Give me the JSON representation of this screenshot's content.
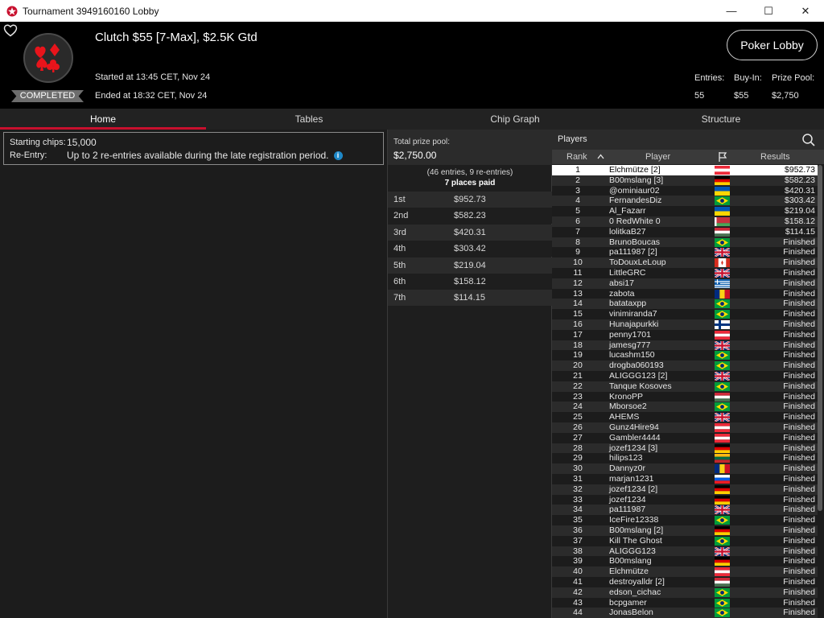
{
  "window": {
    "title": "Tournament 3949160160 Lobby",
    "minimize": "—",
    "maximize": "☐",
    "close": "✕"
  },
  "header": {
    "tournament_name": "Clutch $55 [7-Max], $2.5K Gtd",
    "status": "COMPLETED",
    "started": "Started at 13:45 CET, Nov 24",
    "ended": "Ended at 18:32 CET, Nov 24",
    "poker_lobby_label": "Poker Lobby",
    "entries_label": "Entries:",
    "entries_value": "55",
    "buyin_label": "Buy-In:",
    "buyin_value": "$55",
    "prizepool_label": "Prize Pool:",
    "prizepool_value": "$2,750"
  },
  "tabs": [
    {
      "label": "Home",
      "active": true
    },
    {
      "label": "Tables",
      "active": false
    },
    {
      "label": "Chip Graph",
      "active": false
    },
    {
      "label": "Structure",
      "active": false
    }
  ],
  "home": {
    "starting_chips_label": "Starting chips:",
    "starting_chips_value": "15,000",
    "reentry_label": "Re-Entry:",
    "reentry_value": "Up to 2 re-entries available during the late registration period.",
    "info_icon": "i"
  },
  "prize": {
    "total_label": "Total prize pool:",
    "total_value": "$2,750.00",
    "entries_note": "(46 entries, 9 re-entries)",
    "places_paid": "7 places paid",
    "places": [
      {
        "place": "1st",
        "amount": "$952.73"
      },
      {
        "place": "2nd",
        "amount": "$582.23"
      },
      {
        "place": "3rd",
        "amount": "$420.31"
      },
      {
        "place": "4th",
        "amount": "$303.42"
      },
      {
        "place": "5th",
        "amount": "$219.04"
      },
      {
        "place": "6th",
        "amount": "$158.12"
      },
      {
        "place": "7th",
        "amount": "$114.15"
      }
    ]
  },
  "players": {
    "title": "Players",
    "columns": {
      "rank": "Rank",
      "player": "Player",
      "results": "Results"
    },
    "rows": [
      {
        "rank": "1",
        "name": "Elchmütze [2]",
        "flag": "austria",
        "result": "$952.73"
      },
      {
        "rank": "2",
        "name": "B00mslang [3]",
        "flag": "germany",
        "result": "$582.23"
      },
      {
        "rank": "3",
        "name": "@ominiaur02",
        "flag": "ukraine",
        "result": "$420.31"
      },
      {
        "rank": "4",
        "name": "FernandesDiz",
        "flag": "brazil",
        "result": "$303.42"
      },
      {
        "rank": "5",
        "name": "Al_Fazarr",
        "flag": "ukraine",
        "result": "$219.04"
      },
      {
        "rank": "6",
        "name": "0 RedWhite 0",
        "flag": "belarus",
        "result": "$158.12"
      },
      {
        "rank": "7",
        "name": "lolitkaB27",
        "flag": "hungary",
        "result": "$114.15"
      },
      {
        "rank": "8",
        "name": "BrunoBoucas",
        "flag": "brazil",
        "result": "Finished"
      },
      {
        "rank": "9",
        "name": "pa111987 [2]",
        "flag": "uk",
        "result": "Finished"
      },
      {
        "rank": "10",
        "name": "ToDouxLeLoup",
        "flag": "canada",
        "result": "Finished"
      },
      {
        "rank": "11",
        "name": "LittleGRC",
        "flag": "uk",
        "result": "Finished"
      },
      {
        "rank": "12",
        "name": "absi17",
        "flag": "greece",
        "result": "Finished"
      },
      {
        "rank": "13",
        "name": "zabota",
        "flag": "romania",
        "result": "Finished"
      },
      {
        "rank": "14",
        "name": "batataxpp",
        "flag": "brazil",
        "result": "Finished"
      },
      {
        "rank": "15",
        "name": "vinimiranda7",
        "flag": "brazil",
        "result": "Finished"
      },
      {
        "rank": "16",
        "name": "Hunajapurkki",
        "flag": "finland",
        "result": "Finished"
      },
      {
        "rank": "17",
        "name": "penny1701",
        "flag": "austria",
        "result": "Finished"
      },
      {
        "rank": "18",
        "name": "jamesg777",
        "flag": "uk",
        "result": "Finished"
      },
      {
        "rank": "19",
        "name": "lucashm150",
        "flag": "brazil",
        "result": "Finished"
      },
      {
        "rank": "20",
        "name": "drogba060193",
        "flag": "brazil",
        "result": "Finished"
      },
      {
        "rank": "21",
        "name": "ALIGGG123 [2]",
        "flag": "uk",
        "result": "Finished"
      },
      {
        "rank": "22",
        "name": "Tanque Kosoves",
        "flag": "brazil",
        "result": "Finished"
      },
      {
        "rank": "23",
        "name": "KronoPP",
        "flag": "hungary",
        "result": "Finished"
      },
      {
        "rank": "24",
        "name": "Mborsoe2",
        "flag": "brazil",
        "result": "Finished"
      },
      {
        "rank": "25",
        "name": "AHEMS",
        "flag": "uk",
        "result": "Finished"
      },
      {
        "rank": "26",
        "name": "Gunz4Hire94",
        "flag": "austria",
        "result": "Finished"
      },
      {
        "rank": "27",
        "name": "Gambler4444",
        "flag": "austria",
        "result": "Finished"
      },
      {
        "rank": "28",
        "name": "jozef1234 [3]",
        "flag": "germany",
        "result": "Finished"
      },
      {
        "rank": "29",
        "name": "hilips123",
        "flag": "lithuania",
        "result": "Finished"
      },
      {
        "rank": "30",
        "name": "Dannyz0r",
        "flag": "romania",
        "result": "Finished"
      },
      {
        "rank": "31",
        "name": "marjan1231",
        "flag": "slovenia",
        "result": "Finished"
      },
      {
        "rank": "32",
        "name": "jozef1234 [2]",
        "flag": "germany",
        "result": "Finished"
      },
      {
        "rank": "33",
        "name": "jozef1234",
        "flag": "germany",
        "result": "Finished"
      },
      {
        "rank": "34",
        "name": "pa111987",
        "flag": "uk",
        "result": "Finished"
      },
      {
        "rank": "35",
        "name": "IceFire12338",
        "flag": "brazil",
        "result": "Finished"
      },
      {
        "rank": "36",
        "name": "B00mslang [2]",
        "flag": "germany",
        "result": "Finished"
      },
      {
        "rank": "37",
        "name": "Kill The Ghost",
        "flag": "brazil",
        "result": "Finished"
      },
      {
        "rank": "38",
        "name": "ALIGGG123",
        "flag": "uk",
        "result": "Finished"
      },
      {
        "rank": "39",
        "name": "B00mslang",
        "flag": "germany",
        "result": "Finished"
      },
      {
        "rank": "40",
        "name": "Elchmütze",
        "flag": "austria",
        "result": "Finished"
      },
      {
        "rank": "41",
        "name": "destroyalldr [2]",
        "flag": "hungary",
        "result": "Finished"
      },
      {
        "rank": "42",
        "name": "edson_cichac",
        "flag": "brazil",
        "result": "Finished"
      },
      {
        "rank": "43",
        "name": "bcpgamer",
        "flag": "brazil",
        "result": "Finished"
      },
      {
        "rank": "44",
        "name": "JonasBelon",
        "flag": "brazil",
        "result": "Finished"
      }
    ]
  },
  "colors": {
    "accent": "#c8102e",
    "header_bg": "#000000",
    "panel_bg": "#1c1c1c",
    "highlight_row": "#ffffff"
  }
}
